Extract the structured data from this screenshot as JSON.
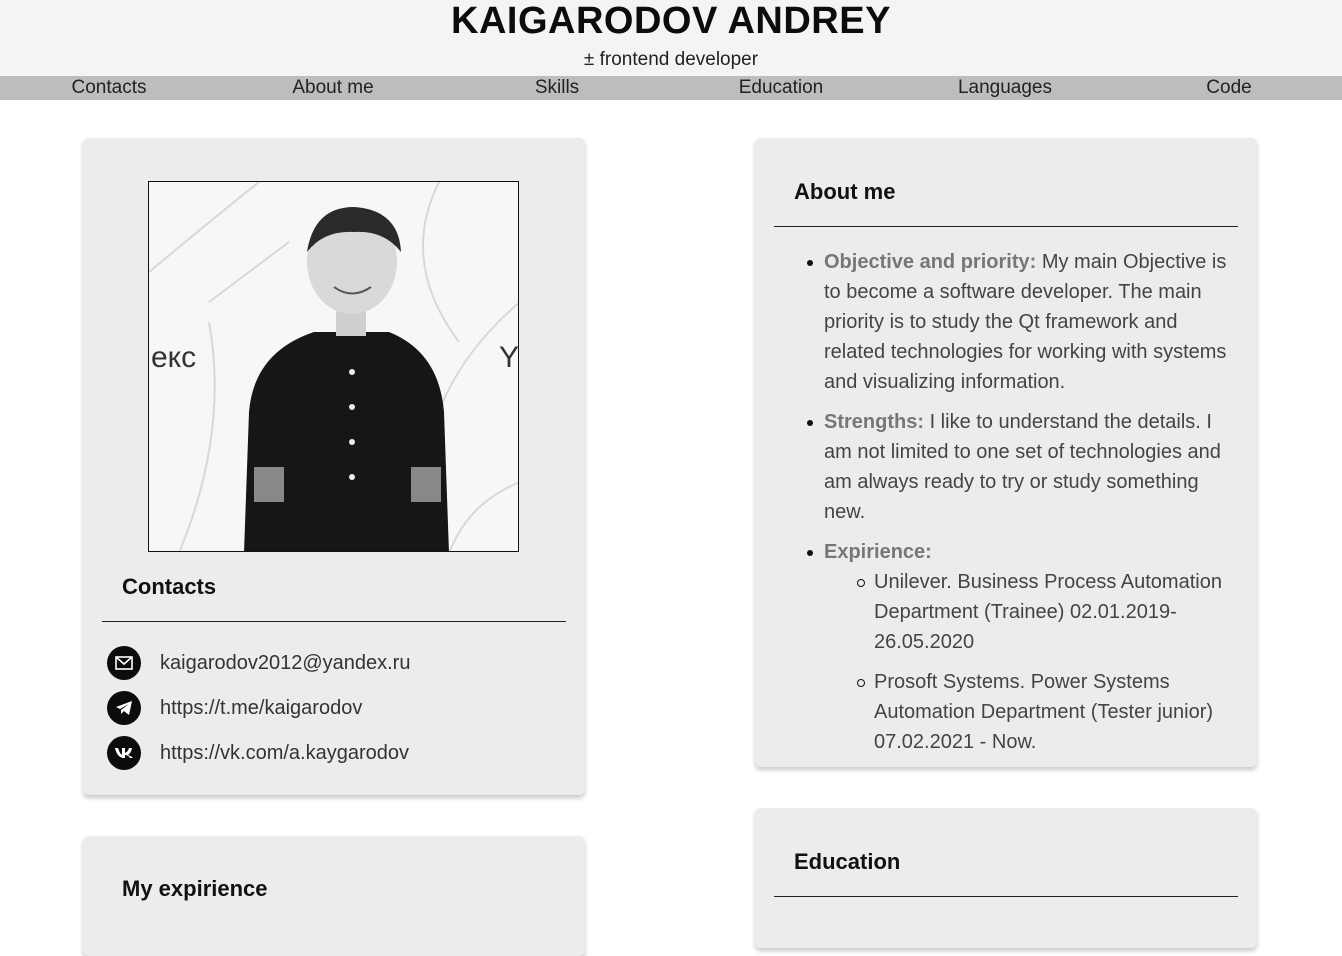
{
  "header": {
    "name": "KAIGARODOV ANDREY",
    "role": "± frontend developer"
  },
  "nav": {
    "items": [
      {
        "label": "Contacts"
      },
      {
        "label": "About me"
      },
      {
        "label": "Skills"
      },
      {
        "label": "Education"
      },
      {
        "label": "Languages"
      },
      {
        "label": "Code"
      }
    ]
  },
  "contacts": {
    "title": "Contacts",
    "items": [
      {
        "icon": "mail-icon",
        "text": "kaigarodov2012@yandex.ru"
      },
      {
        "icon": "telegram-icon",
        "text": "https://t.me/kaigarodov"
      },
      {
        "icon": "vk-icon",
        "text": "https://vk.com/a.kaygarodov"
      }
    ]
  },
  "experience_card": {
    "title": "My expirience"
  },
  "about": {
    "title": "About me",
    "objective_label": "Objective and priority:",
    "objective_text": "My main Objective is to become a software developer. The main priority is to study the Qt framework and related technologies for working with systems and visualizing information.",
    "strengths_label": "Strengths:",
    "strengths_text": "I like to understand the details. I am not limited to one set of technologies and am always ready to try or study something new.",
    "experience_label": "Expirience:",
    "experience_items": [
      "Unilever. Business Process Automation Department (Trainee) 02.01.2019-26.05.2020",
      "Prosoft Systems. Power Systems Automation Department (Tester junior) 07.02.2021 - Now."
    ]
  },
  "education_card": {
    "title": "Education"
  },
  "photo": {
    "backdrop_left": "екс",
    "backdrop_right": "Y"
  }
}
